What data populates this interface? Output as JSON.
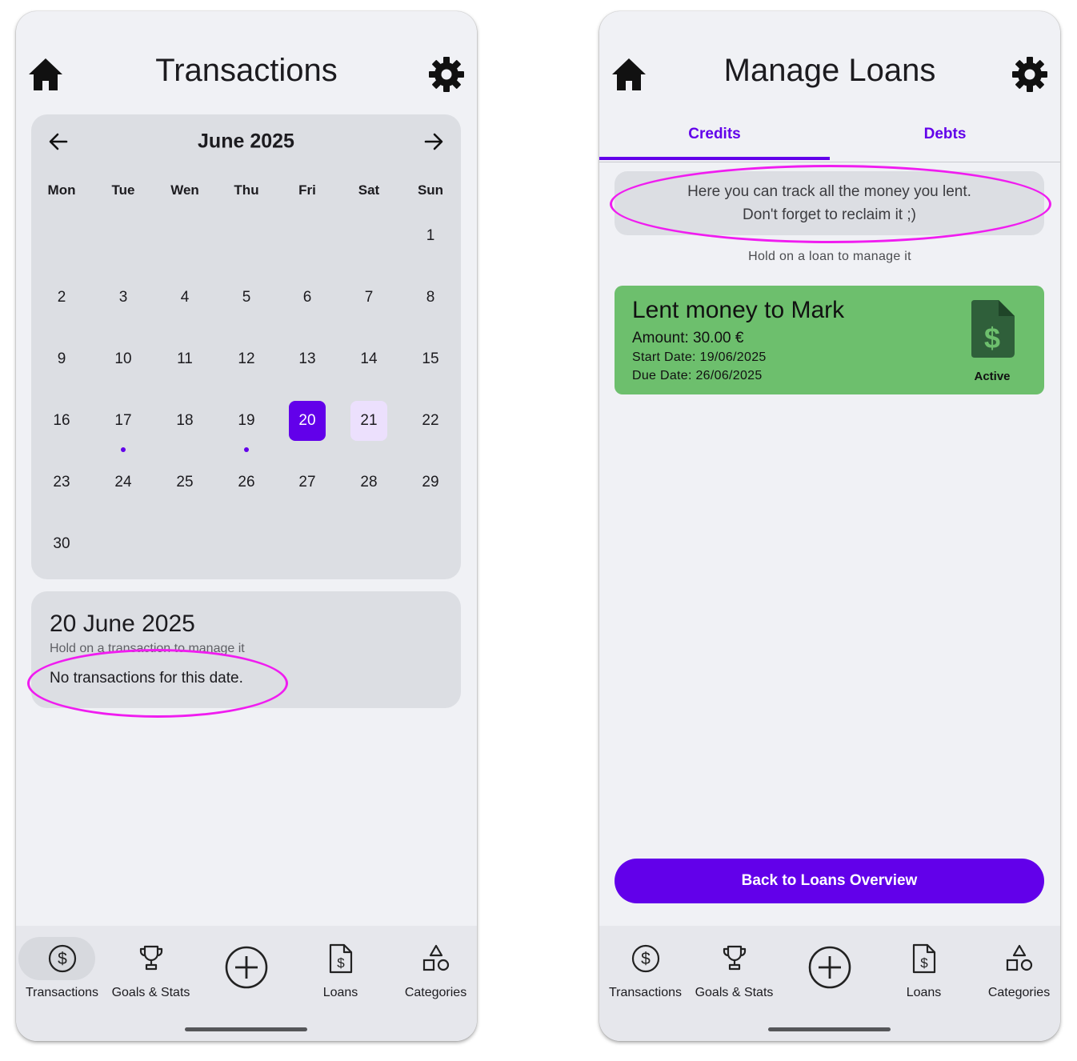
{
  "colors": {
    "accent": "#6200ea",
    "today_highlight": "#ece0fd",
    "loan_card": "#6dbf6d",
    "annotation": "#f01cf0"
  },
  "left": {
    "title": "Transactions",
    "calendar": {
      "month_label": "June 2025",
      "weekdays": [
        "Mon",
        "Tue",
        "Wen",
        "Thu",
        "Fri",
        "Sat",
        "Sun"
      ],
      "days": [
        "1",
        "2",
        "3",
        "4",
        "5",
        "6",
        "7",
        "8",
        "9",
        "10",
        "11",
        "12",
        "13",
        "14",
        "15",
        "16",
        "17",
        "18",
        "19",
        "20",
        "21",
        "22",
        "23",
        "24",
        "25",
        "26",
        "27",
        "28",
        "29",
        "30"
      ],
      "selected_day": "20",
      "today_day": "21",
      "days_with_transactions": [
        "17",
        "19"
      ]
    },
    "selected_date": {
      "title": "20 June 2025",
      "hint": "Hold on a transaction to manage it",
      "empty_message": "No transactions for this date."
    }
  },
  "right": {
    "title": "Manage Loans",
    "tabs": [
      "Credits",
      "Debts"
    ],
    "active_tab": "Credits",
    "info_line1": "Here you can track all the money you lent.",
    "info_line2": "Don't forget to reclaim it ;)",
    "hold_hint": "Hold on a loan to manage it",
    "loan": {
      "title": "Lent money to Mark",
      "amount": "Amount: 30.00 €",
      "start_date": "Start Date: 19/06/2025",
      "due_date": "Due Date: 26/06/2025",
      "status": "Active",
      "icon": "file-dollar-icon"
    },
    "back_button": "Back to Loans Overview"
  },
  "nav": {
    "transactions": "Transactions",
    "goals": "Goals & Stats",
    "add": "add-circle-icon",
    "loans": "Loans",
    "categories": "Categories"
  }
}
